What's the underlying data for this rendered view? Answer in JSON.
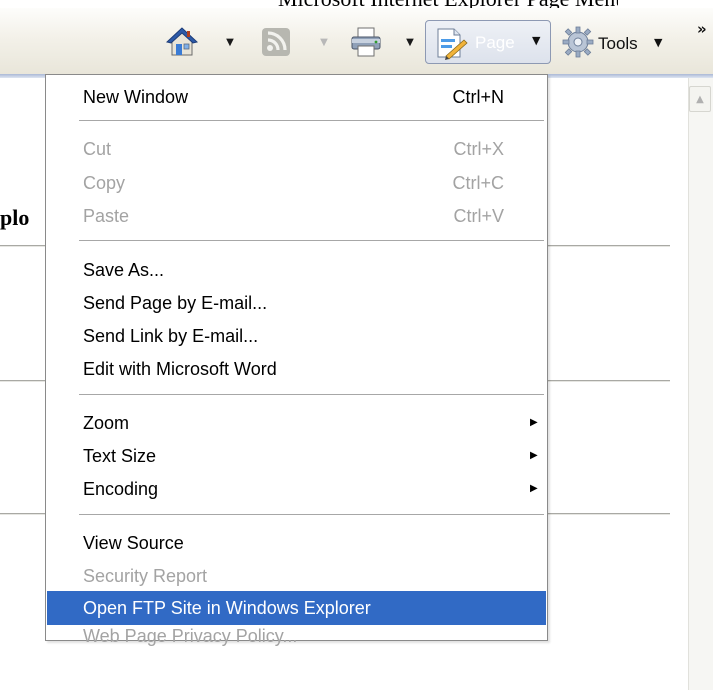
{
  "top_caption": "Microsoft Internet Explorer Page Menu",
  "toolbar": {
    "buttons": [
      {
        "name": "home",
        "icon": "home-icon"
      },
      {
        "name": "feeds",
        "icon": "rss-feed-icon",
        "disabled": true
      },
      {
        "name": "print",
        "icon": "printer-icon"
      },
      {
        "name": "page",
        "icon": "page-edit-icon",
        "label": "Page"
      },
      {
        "name": "tools",
        "icon": "gear-icon",
        "label": "Tools"
      }
    ],
    "page_label": "Page",
    "tools_label": "Tools",
    "overflow_icon": "chevron-double-right-icon",
    "overflow_glyph": "»"
  },
  "background": {
    "heading_fragment": "plo"
  },
  "menu": {
    "groups": [
      [
        {
          "label": "New Window",
          "shortcut": "Ctrl+N",
          "enabled": true
        }
      ],
      [
        {
          "label": "Cut",
          "shortcut": "Ctrl+X",
          "enabled": false
        },
        {
          "label": "Copy",
          "shortcut": "Ctrl+C",
          "enabled": false
        },
        {
          "label": "Paste",
          "shortcut": "Ctrl+V",
          "enabled": false
        }
      ],
      [
        {
          "label": "Save As...",
          "enabled": true
        },
        {
          "label": "Send Page by E-mail...",
          "enabled": true
        },
        {
          "label": "Send Link by E-mail...",
          "enabled": true
        },
        {
          "label": "Edit with Microsoft Word",
          "enabled": true
        }
      ],
      [
        {
          "label": "Zoom",
          "submenu": true,
          "enabled": true
        },
        {
          "label": "Text Size",
          "submenu": true,
          "enabled": true
        },
        {
          "label": "Encoding",
          "submenu": true,
          "enabled": true
        }
      ],
      [
        {
          "label": "View Source",
          "enabled": true
        },
        {
          "label": "Security Report",
          "enabled": false
        },
        {
          "label": "Open FTP Site in Windows Explorer",
          "enabled": true,
          "selected": true
        },
        {
          "label": "Web Page Privacy Policy...",
          "enabled": false
        }
      ]
    ]
  },
  "colors": {
    "selection": "#316ac5",
    "disabled_text": "#a3a3a3",
    "toolbar_top": "#fdfdfb",
    "toolbar_bottom": "#e9e6da"
  }
}
